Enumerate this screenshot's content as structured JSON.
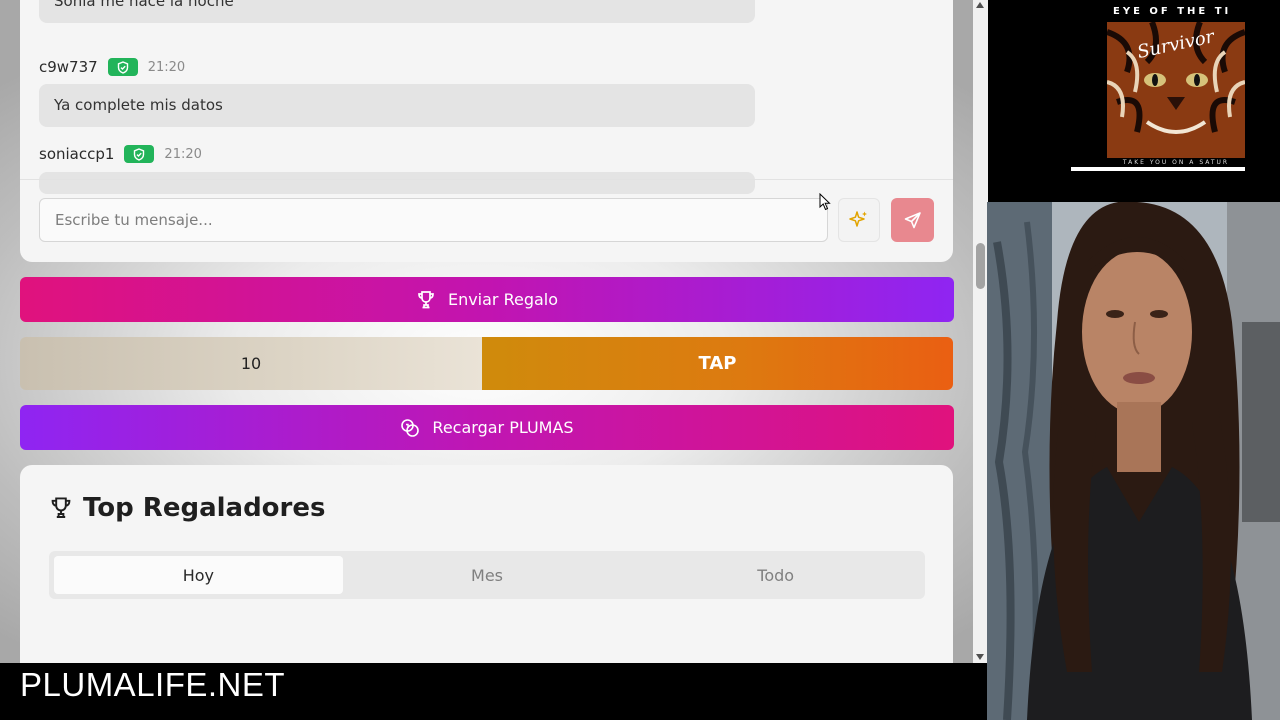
{
  "chat": {
    "messages": [
      {
        "text": "Sonia me hace la noche"
      },
      {
        "user": "c9w737",
        "time": "21:20",
        "text": "Ya complete mis datos"
      },
      {
        "user": "soniaccp1",
        "time": "21:20",
        "text": ""
      }
    ],
    "input_placeholder": "Escribe tu mensaje..."
  },
  "buttons": {
    "gift": "Enviar Regalo",
    "tap_count": "10",
    "tap": "TAP",
    "reload": "Recargar PLUMAS"
  },
  "top_givers": {
    "title": "Top Regaladores",
    "tabs": [
      "Hoy",
      "Mes",
      "Todo"
    ],
    "active_tab": "Hoy"
  },
  "overlay": {
    "brand": "PLUMALIFE.NET"
  },
  "album": {
    "header": "EYE OF THE TI",
    "footer": "TAKE YOU ON A SATUR"
  },
  "colors": {
    "verified_badge": "#22b45a",
    "send_button": "#e8888f",
    "gift_gradient": [
      "#e0127d",
      "#8f25f2"
    ],
    "tap_gradient": [
      "#cf8b0c",
      "#ea5f12"
    ]
  },
  "icons": [
    "shield-check-icon",
    "sparkles-icon",
    "send-icon",
    "trophy-icon",
    "coins-icon",
    "cursor-icon"
  ]
}
